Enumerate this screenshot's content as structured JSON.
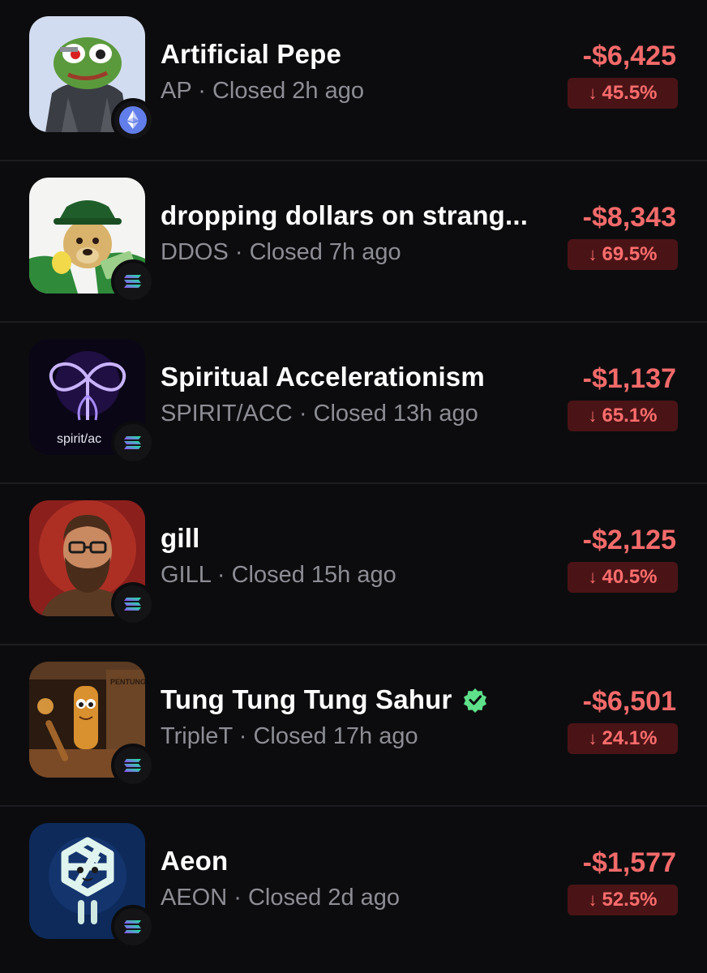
{
  "colors": {
    "background": "#0c0c0e",
    "divider": "#1d1d21",
    "loss": "#f36a6a",
    "loss_badge_bg": "#4a1416",
    "subtext": "#8d8d95",
    "verified": "#5ee08a"
  },
  "positions": [
    {
      "name": "Artificial Pepe",
      "ticker": "AP",
      "status": "Closed 2h ago",
      "pnl": "-$6,425",
      "pct": "45.5%",
      "chain": "ethereum-icon",
      "avatar": "pepe-avatar",
      "verified": false
    },
    {
      "name": "dropping dollars on strang...",
      "ticker": "DDOS",
      "status": "Closed 7h ago",
      "pnl": "-$8,343",
      "pct": "69.5%",
      "chain": "solana-icon",
      "avatar": "dog-money-avatar",
      "verified": false
    },
    {
      "name": "Spiritual Accelerationism",
      "ticker": "SPIRIT/ACC",
      "status": "Closed 13h ago",
      "pnl": "-$1,137",
      "pct": "65.1%",
      "chain": "solana-icon",
      "avatar": "spirit-acc-avatar",
      "avatar_text": "spirit/ac",
      "verified": false
    },
    {
      "name": "gill",
      "ticker": "GILL",
      "status": "Closed 15h ago",
      "pnl": "-$2,125",
      "pct": "40.5%",
      "chain": "solana-icon",
      "avatar": "bearded-man-avatar",
      "verified": false
    },
    {
      "name": "Tung Tung Tung Sahur",
      "ticker": "TripleT",
      "status": "Closed 17h ago",
      "pnl": "-$6,501",
      "pct": "24.1%",
      "chain": "solana-icon",
      "avatar": "tung-sahur-avatar",
      "avatar_text": "PENTUNG FOS RONI",
      "verified": true
    },
    {
      "name": "Aeon",
      "ticker": "AEON",
      "status": "Closed 2d ago",
      "pnl": "-$1,577",
      "pct": "52.5%",
      "chain": "solana-icon",
      "avatar": "aeon-avatar",
      "verified": false
    }
  ],
  "separator": "·",
  "down_arrow": "↓"
}
